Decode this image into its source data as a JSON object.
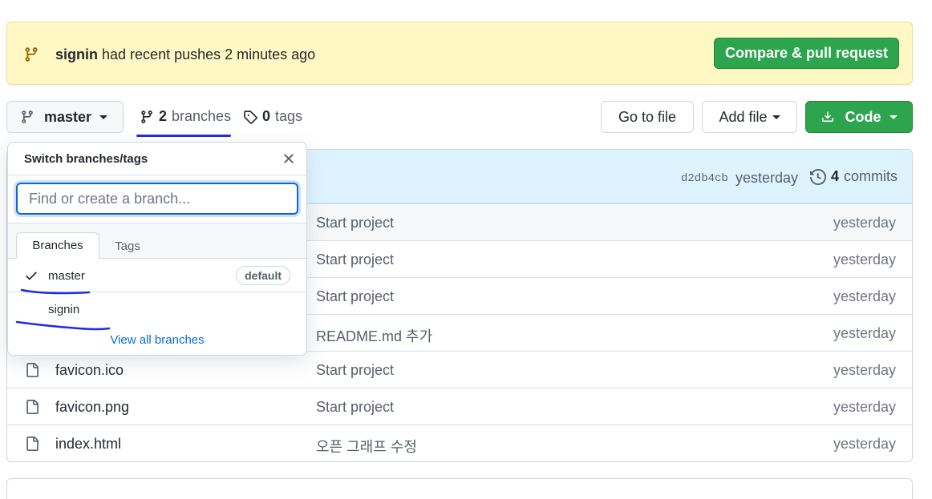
{
  "banner": {
    "branch": "signin",
    "message": "had recent pushes 2 minutes ago",
    "compare_label": "Compare & pull request"
  },
  "toolbar": {
    "current_branch": "master",
    "branches_count": "2",
    "branches_label": "branches",
    "tags_count": "0",
    "tags_label": "tags",
    "goto_label": "Go to file",
    "addfile_label": "Add file",
    "code_label": "Code"
  },
  "commit": {
    "sha": "d2db4cb",
    "when": "yesterday",
    "count": "4",
    "count_label": "commits"
  },
  "files": [
    {
      "name": "",
      "message": "Start project",
      "date": "yesterday"
    },
    {
      "name": "",
      "message": "Start project",
      "date": "yesterday"
    },
    {
      "name": "",
      "message": "Start project",
      "date": "yesterday"
    },
    {
      "name": "",
      "message": "README.md 추가",
      "date": "yesterday"
    },
    {
      "name": "favicon.ico",
      "message": "Start project",
      "date": "yesterday"
    },
    {
      "name": "favicon.png",
      "message": "Start project",
      "date": "yesterday"
    },
    {
      "name": "index.html",
      "message": "오픈 그래프 수정",
      "date": "yesterday"
    }
  ],
  "dropdown": {
    "title": "Switch branches/tags",
    "search_placeholder": "Find or create a branch...",
    "tab_branches": "Branches",
    "tab_tags": "Tags",
    "branches": [
      {
        "name": "master",
        "badge": "default"
      },
      {
        "name": "signin",
        "badge": ""
      }
    ],
    "view_all": "View all branches"
  },
  "colors": {
    "accent_green": "#2da44e",
    "link_blue": "#0969da",
    "banner_bg": "#fff8c5",
    "annotation_blue": "#1e2ee0"
  }
}
